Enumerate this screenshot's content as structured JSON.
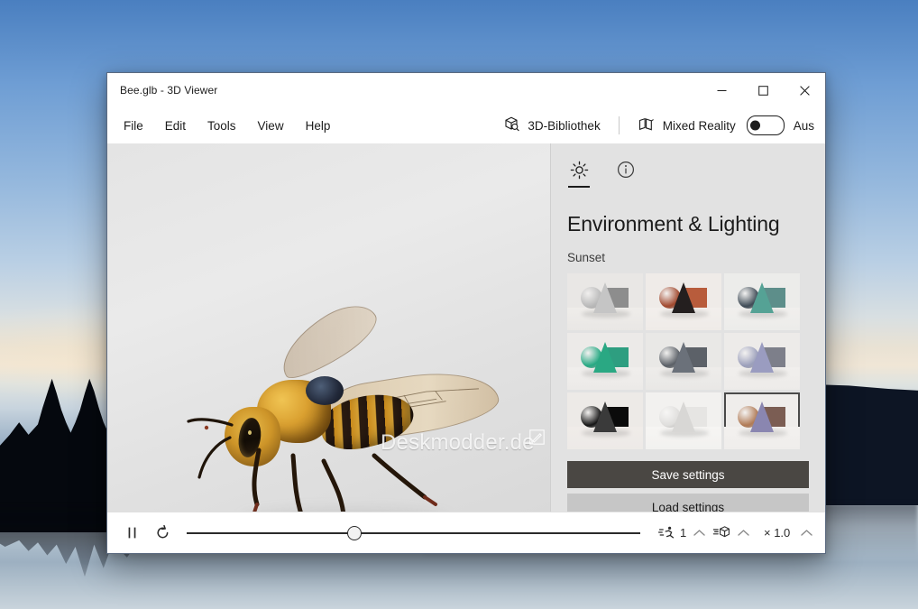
{
  "window": {
    "title": "Bee.glb - 3D Viewer",
    "controls": {
      "minimize": "minimize-button",
      "maximize": "maximize-button",
      "close": "close-button"
    }
  },
  "menu": {
    "items": [
      {
        "label": "File"
      },
      {
        "label": "Edit"
      },
      {
        "label": "Tools"
      },
      {
        "label": "View"
      },
      {
        "label": "Help"
      }
    ],
    "library_label": "3D-Bibliothek",
    "mixed_reality_label": "Mixed Reality",
    "mixed_reality_state": "Aus"
  },
  "viewport": {
    "watermark": "Deskmodder.de",
    "model": "bee"
  },
  "panel": {
    "tabs": [
      {
        "name": "lighting",
        "icon": "brightness-icon",
        "active": true
      },
      {
        "name": "info",
        "icon": "info-icon",
        "active": false
      }
    ],
    "title": "Environment & Lighting",
    "environment_name": "Sunset",
    "thumbnails": [
      {
        "name": "studio-grey",
        "bg": "#e9e7e5",
        "floor": "#efedea",
        "sphere": "#b9b9b9",
        "cone": "#c5c5c5",
        "cube": "#8d8d8d",
        "selected": false
      },
      {
        "name": "sunset-warm",
        "bg": "#efebe8",
        "floor": "#f2efec",
        "sphere": "#a0472c",
        "cone": "#241f1f",
        "cube": "#b85c3c",
        "selected": false
      },
      {
        "name": "teal-soft",
        "bg": "#ececea",
        "floor": "#f1efed",
        "sphere": "#3e4a55",
        "cone": "#55a295",
        "cube": "#5d8e8a",
        "selected": false
      },
      {
        "name": "green-bright",
        "bg": "#eceae8",
        "floor": "#f0eeec",
        "sphere": "#25a882",
        "cone": "#2aa883",
        "cube": "#2e9e80",
        "selected": false
      },
      {
        "name": "neutral-dim",
        "bg": "#e9e8e6",
        "floor": "#eeecea",
        "sphere": "#5a5f66",
        "cone": "#6b717a",
        "cube": "#5c6168",
        "selected": false
      },
      {
        "name": "violet-light",
        "bg": "#edebe9",
        "floor": "#f1efed",
        "sphere": "#9b9fbb",
        "cone": "#9a9cc0",
        "cube": "#7d7f8a",
        "selected": false
      },
      {
        "name": "dark-contrast",
        "bg": "#edeae7",
        "floor": "#f0ece9",
        "sphere": "#151515",
        "cone": "#3a3a3a",
        "cube": "#0b0b0b",
        "selected": false
      },
      {
        "name": "white-soft",
        "bg": "#f2f1ef",
        "floor": "#f6f5f3",
        "sphere": "#dfdedc",
        "cone": "#d8d7d5",
        "cube": "#e6e5e3",
        "selected": false
      },
      {
        "name": "sunset",
        "bg": "#efedeb",
        "floor": "#f3f1ef",
        "sphere": "#b07a55",
        "cone": "#8a86b0",
        "cube": "#7b5d53",
        "selected": true
      }
    ],
    "buttons": {
      "save": "Save settings",
      "load": "Load settings"
    }
  },
  "bottombar": {
    "play_pause_icon": "pause-icon",
    "repeat_icon": "repeat-icon",
    "slider_position_percent": 37,
    "animation": {
      "icon": "animation-icon",
      "value": "1",
      "chevron": "chevron-up-icon"
    },
    "model": {
      "icon": "model-icon",
      "value": "",
      "chevron": "chevron-up-icon"
    },
    "speed": {
      "label": "× 1.0",
      "chevron": "chevron-up-icon"
    }
  },
  "colors": {
    "accent_dark": "#4a4743",
    "panel_bg": "#e2e2e2",
    "window_border": "#5b6a80"
  }
}
